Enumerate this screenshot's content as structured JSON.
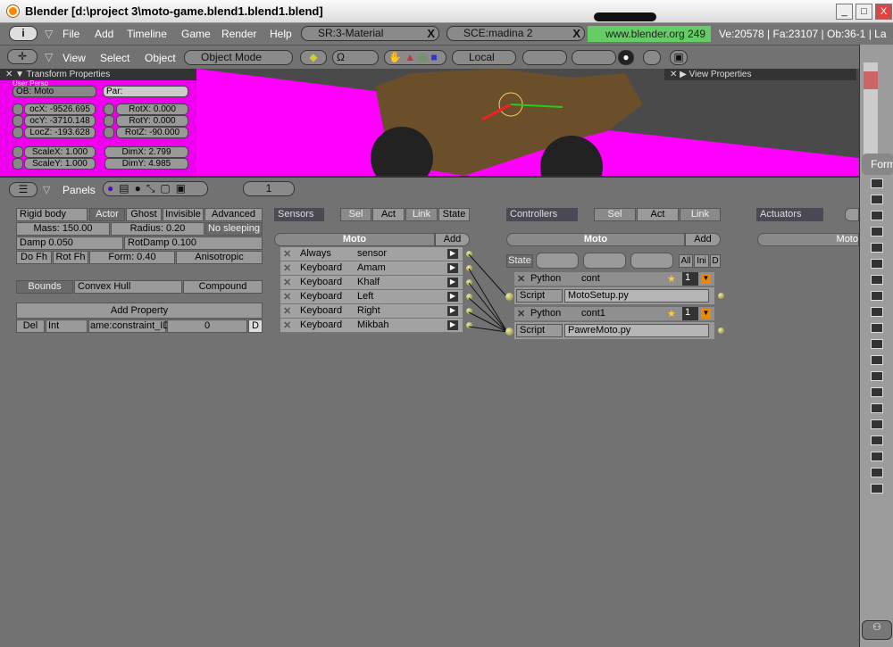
{
  "window": {
    "title": "Blender [d:\\project 3\\moto-game.blend1.blend1.blend]",
    "min": "_",
    "max": "□",
    "close": "X"
  },
  "menubar": {
    "items": [
      "File",
      "Add",
      "Timeline",
      "Game",
      "Render",
      "Help"
    ],
    "screen": "SR:3-Material",
    "scene": "SCE:madina 2",
    "url": "www.blender.org 249",
    "stats": "Ve:20578 | Fa:23107 | Ob:36-1 | La"
  },
  "view_header": {
    "menus": [
      "View",
      "Select",
      "Object"
    ],
    "mode": "Object Mode",
    "orientation": "Local"
  },
  "transform": {
    "title": "Transform Properties",
    "view_label": "User Persp",
    "ob": "OB: Moto",
    "par": "Par:",
    "loc": [
      "ocX: -9526.695",
      "ocY: -3710.148",
      "LocZ: -193.628"
    ],
    "rot": [
      "RotX: 0.000",
      "RotY: 0.000",
      "RotZ: -90.000"
    ],
    "scale": [
      "ScaleX: 1.000",
      "ScaleY: 1.000"
    ],
    "dim": [
      "DimX: 2.799",
      "DimY: 4.985"
    ]
  },
  "view_props": {
    "title": "View Properties"
  },
  "right_col": {
    "label": "Form"
  },
  "logic_header": {
    "panels_label": "Panels",
    "frame": "1"
  },
  "physics": {
    "type": "Rigid body",
    "actor": "Actor",
    "ghost": "Ghost",
    "invisible": "Invisible",
    "advanced": "Advanced",
    "mass": "Mass: 150.00",
    "radius": "Radius: 0.20",
    "no_sleeping": "No sleeping",
    "damp": "Damp 0.050",
    "rotdamp": "RotDamp 0.100",
    "do_fh": "Do Fh",
    "rot_fh": "Rot Fh",
    "form": "Form: 0.40",
    "aniso": "Anisotropic",
    "bounds": "Bounds",
    "bounds_type": "Convex Hull",
    "compound": "Compound",
    "add_prop": "Add Property",
    "prop_del": "Del",
    "prop_type": "Int",
    "prop_name": "ame:constraint_ID",
    "prop_value": "0",
    "prop_d": "D"
  },
  "sensors": {
    "title": "Sensors",
    "filters": [
      "Sel",
      "Act",
      "Link",
      "State"
    ],
    "object": "Moto",
    "add": "Add",
    "items": [
      {
        "type": "Always",
        "name": "sensor"
      },
      {
        "type": "Keyboard",
        "name": "Amam"
      },
      {
        "type": "Keyboard",
        "name": "Khalf"
      },
      {
        "type": "Keyboard",
        "name": "Left"
      },
      {
        "type": "Keyboard",
        "name": "Right"
      },
      {
        "type": "Keyboard",
        "name": "Mikbah"
      }
    ]
  },
  "controllers": {
    "title": "Controllers",
    "filters": [
      "Sel",
      "Act",
      "Link"
    ],
    "object": "Moto",
    "add": "Add",
    "state": "State",
    "all": "All",
    "ini": "Ini",
    "d": "D",
    "items": [
      {
        "type": "Python",
        "name": "cont",
        "num": "1",
        "script_label": "Script",
        "script": "MotoSetup.py"
      },
      {
        "type": "Python",
        "name": "cont1",
        "num": "1",
        "script_label": "Script",
        "script": "PawreMoto.py"
      }
    ]
  },
  "actuators": {
    "title": "Actuators",
    "object": "Moto"
  }
}
